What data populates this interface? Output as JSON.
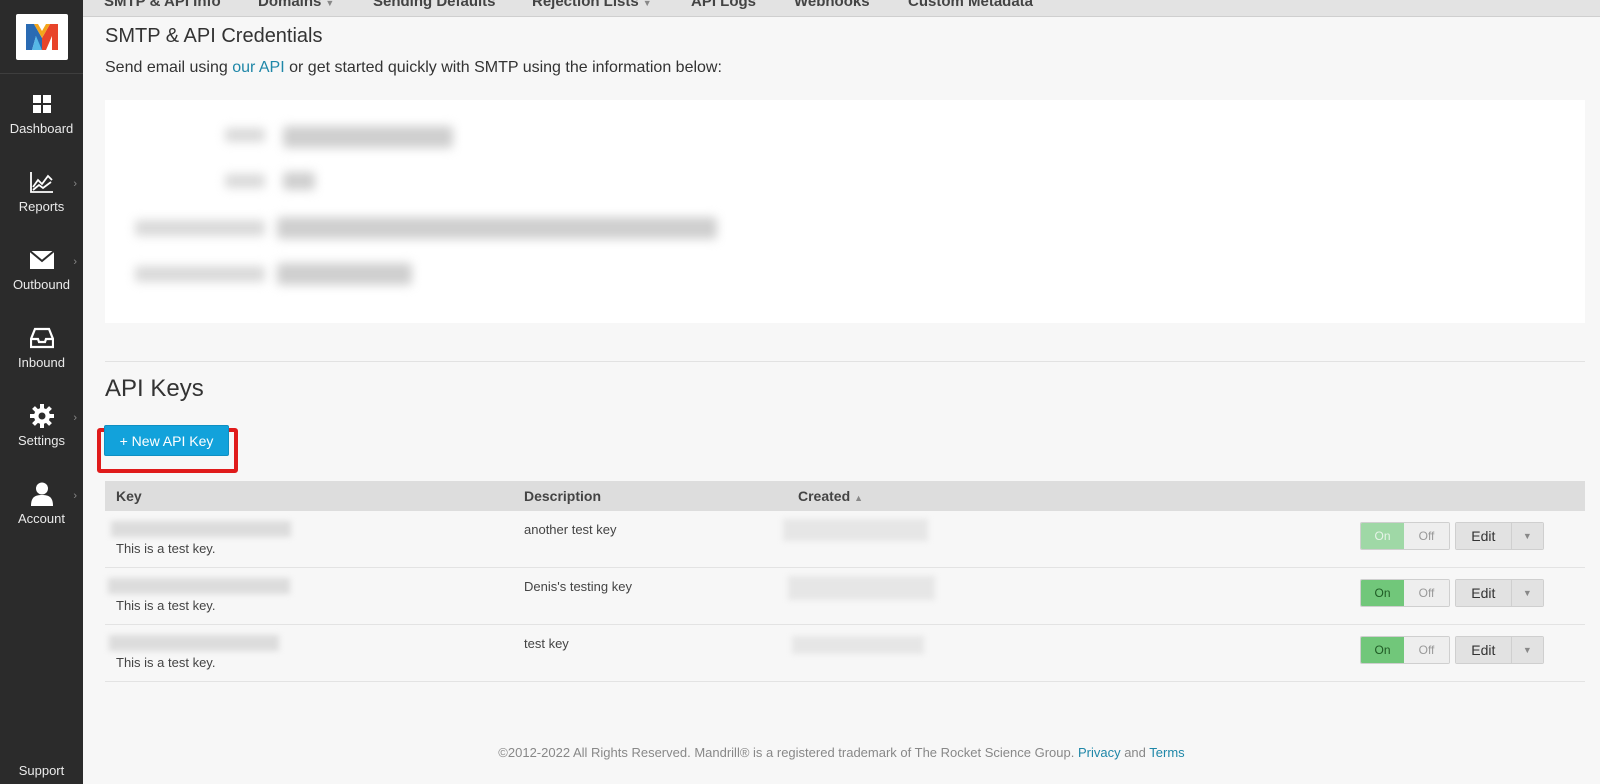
{
  "tabs": [
    {
      "label": "SMTP & API Info",
      "has_caret": false
    },
    {
      "label": "Domains",
      "has_caret": true
    },
    {
      "label": "Sending Defaults",
      "has_caret": false
    },
    {
      "label": "Rejection Lists",
      "has_caret": true
    },
    {
      "label": "API Logs",
      "has_caret": false
    },
    {
      "label": "Webhooks",
      "has_caret": false
    },
    {
      "label": "Custom Metadata",
      "has_caret": false
    }
  ],
  "sidebar": {
    "items": [
      {
        "label": "Dashboard",
        "icon": "grid-icon"
      },
      {
        "label": "Reports",
        "icon": "chart-icon"
      },
      {
        "label": "Outbound",
        "icon": "envelope-icon"
      },
      {
        "label": "Inbound",
        "icon": "inbox-icon"
      },
      {
        "label": "Settings",
        "icon": "gear-icon"
      },
      {
        "label": "Account",
        "icon": "user-icon"
      }
    ],
    "support": "Support"
  },
  "credentials": {
    "title": "SMTP & API Credentials",
    "intro_before": "Send email using ",
    "intro_link": "our API",
    "intro_after": " or get started quickly with SMTP using the information below:"
  },
  "api_keys": {
    "title": "API Keys",
    "new_button": "+ New API Key",
    "columns": {
      "key": "Key",
      "description": "Description",
      "created": "Created"
    },
    "rows": [
      {
        "note": "This is a test key.",
        "description": "another test key",
        "on": "On",
        "off": "Off",
        "edit": "Edit",
        "enabled": false
      },
      {
        "note": "This is a test key.",
        "description": "Denis's testing key",
        "on": "On",
        "off": "Off",
        "edit": "Edit",
        "enabled": true
      },
      {
        "note": "This is a test key.",
        "description": "test key",
        "on": "On",
        "off": "Off",
        "edit": "Edit",
        "enabled": true
      }
    ]
  },
  "footer": {
    "text": "©2012-2022 All Rights Reserved. Mandrill® is a registered trademark of The Rocket Science Group.",
    "privacy": "Privacy",
    "and": "and",
    "terms": "Terms"
  },
  "colors": {
    "sidebar_bg": "#2b2b2b",
    "primary_button": "#12a2db",
    "toggle_on": "#71c77a",
    "link": "#1f87a8",
    "highlight": "#e01b1b"
  }
}
